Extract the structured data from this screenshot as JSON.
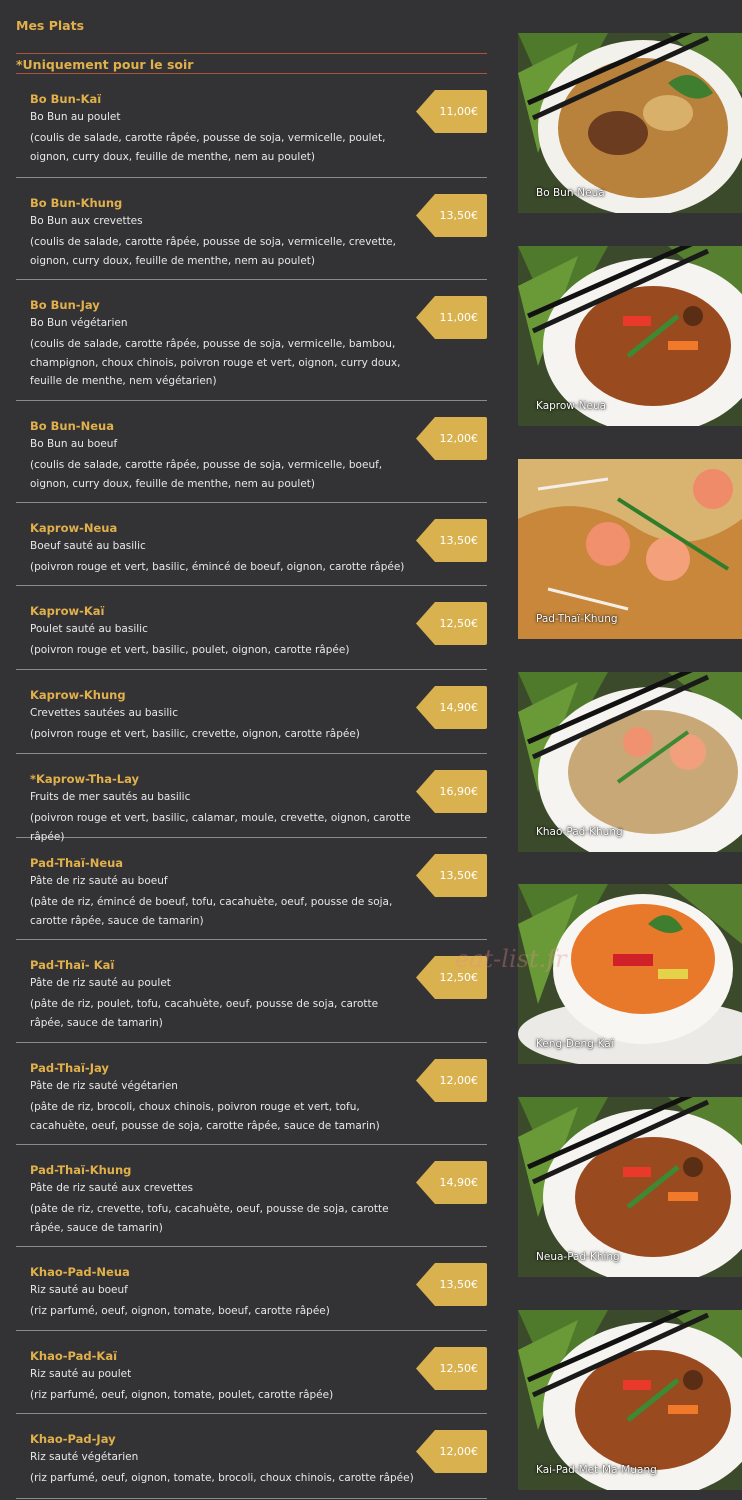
{
  "page_title": "Mes Plats",
  "section_title": "*Uniquement pour le soir",
  "watermark": "eat-list.fr",
  "colors": {
    "background": "#333335",
    "accent": "#e2b04a",
    "price_tag": "#d9b24f",
    "rule": "#a8553a"
  },
  "items": [
    {
      "name": "Bo Bun-Kaï",
      "subtitle": "Bo Bun au poulet",
      "description": "(coulis de salade, carotte râpée, pousse de soja, vermicelle, poulet, oignon, curry doux, feuille de menthe, nem au poulet)",
      "price": "11,00€"
    },
    {
      "name": "Bo Bun-Khung",
      "subtitle": "Bo Bun aux crevettes",
      "description": "(coulis de salade, carotte râpée, pousse de soja, vermicelle, crevette, oignon, curry doux, feuille de menthe, nem au poulet)",
      "price": "13,50€"
    },
    {
      "name": "Bo Bun-Jay",
      "subtitle": "Bo Bun végétarien",
      "description": "(coulis de salade, carotte râpée, pousse de soja, vermicelle, bambou, champignon, choux chinois, poivron rouge et vert, oignon, curry doux, feuille de menthe, nem végétarien)",
      "price": "11,00€"
    },
    {
      "name": "Bo Bun-Neua",
      "subtitle": "Bo Bun au boeuf",
      "description": "(coulis de salade, carotte râpée, pousse de soja, vermicelle, boeuf, oignon, curry doux, feuille de menthe, nem au poulet)",
      "price": "12,00€"
    },
    {
      "name": "Kaprow-Neua",
      "subtitle": "Boeuf sauté au basilic",
      "description": "(poivron rouge et vert, basilic, émincé de boeuf, oignon, carotte râpée)",
      "price": "13,50€"
    },
    {
      "name": "Kaprow-Kaï",
      "subtitle": "Poulet sauté au basilic",
      "description": "(poivron rouge et vert, basilic, poulet, oignon, carotte râpée)",
      "price": "12,50€"
    },
    {
      "name": "Kaprow-Khung",
      "subtitle": "Crevettes sautées au basilic",
      "description": "(poivron rouge et vert, basilic, crevette, oignon, carotte râpée)",
      "price": "14,90€"
    },
    {
      "name": "*Kaprow-Tha-Lay",
      "subtitle": "Fruits de mer sautés au basilic",
      "description": "(poivron rouge et vert, basilic, calamar, moule, crevette, oignon, carotte râpée)",
      "price": "16,90€"
    },
    {
      "name": "Pad-Thaï-Neua",
      "subtitle": "Pâte de riz sauté au boeuf",
      "description": "(pâte de riz, émincé de boeuf, tofu, cacahuète, oeuf, pousse de soja, carotte râpée, sauce de tamarin)",
      "price": "13,50€"
    },
    {
      "name": "Pad-Thaï- Kaï",
      "subtitle": "Pâte de riz sauté au poulet",
      "description": "(pâte de riz, poulet, tofu, cacahuète, oeuf, pousse de soja, carotte râpée, sauce de tamarin)",
      "price": "12,50€"
    },
    {
      "name": "Pad-Thaï-Jay",
      "subtitle": "Pâte de riz sauté végétarien",
      "description": "(pâte de riz, brocoli, choux chinois, poivron rouge et vert, tofu, cacahuète, oeuf, pousse de soja, carotte râpée, sauce de tamarin)",
      "price": "12,00€"
    },
    {
      "name": "Pad-Thaï-Khung",
      "subtitle": "Pâte de riz sauté aux crevettes",
      "description": "(pâte de riz, crevette, tofu, cacahuète, oeuf, pousse de soja, carotte râpée, sauce de tamarin)",
      "price": "14,90€"
    },
    {
      "name": "Khao-Pad-Neua",
      "subtitle": "Riz sauté au boeuf",
      "description": "(riz parfumé, oeuf, oignon, tomate, boeuf, carotte râpée)",
      "price": "13,50€"
    },
    {
      "name": "Khao-Pad-Kaï",
      "subtitle": "Riz sauté au poulet",
      "description": "(riz parfumé, oeuf, oignon, tomate, poulet, carotte râpée)",
      "price": "12,50€"
    },
    {
      "name": "Khao-Pad-Jay",
      "subtitle": "Riz sauté végétarien",
      "description": "(riz parfumé, oeuf, oignon, tomate, brocoli, choux chinois, carotte râpée)",
      "price": "12,00€"
    }
  ],
  "photos": [
    {
      "caption": "Bo Bun-Neua",
      "style": "noodle-bowl"
    },
    {
      "caption": "Kaprow-Neua",
      "style": "stir-fry-plate"
    },
    {
      "caption": "Pad-Thaï-Khung",
      "style": "pad-thai"
    },
    {
      "caption": "Khao-Pad-Khung",
      "style": "fried-rice"
    },
    {
      "caption": "Keng-Deng-Kaï",
      "style": "curry-bowl"
    },
    {
      "caption": "Neua-Pad-Khing",
      "style": "stir-fry-plate"
    },
    {
      "caption": "Kai-Pad-Met-Ma-Muang",
      "style": "stir-fry-plate"
    }
  ]
}
